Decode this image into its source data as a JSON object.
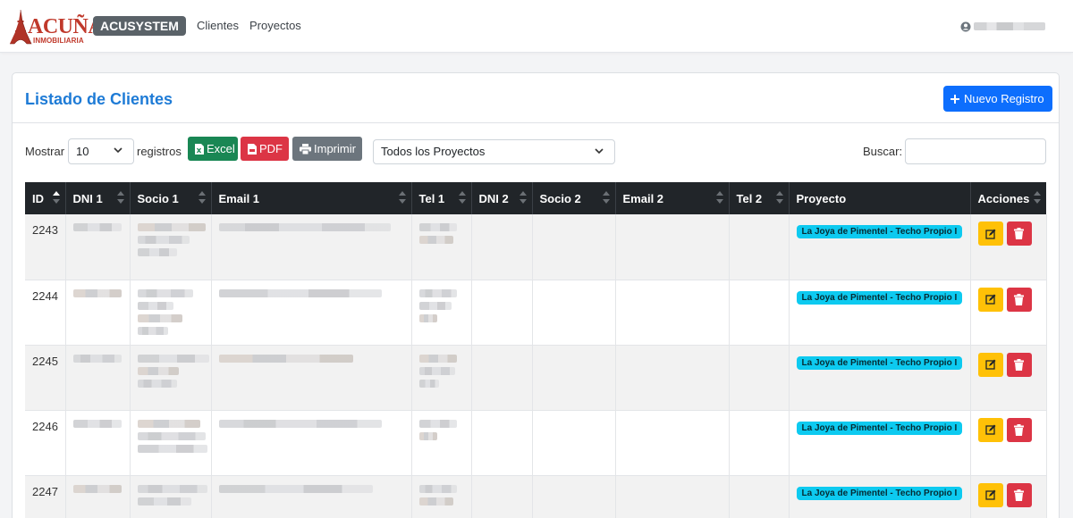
{
  "brand": {
    "logo_text": "ACUÑA",
    "logo_sub": "INMOBILIARIA",
    "app_badge": "ACUSYSTEM"
  },
  "nav": {
    "items": [
      {
        "label": "Clientes"
      },
      {
        "label": "Proyectos"
      }
    ]
  },
  "card": {
    "title": "Listado de Clientes",
    "new_button": "Nuevo Registro"
  },
  "toolbar": {
    "show_label": "Mostrar",
    "page_length": "10",
    "records_label": "registros",
    "excel": "Excel",
    "pdf": "PDF",
    "print": "Imprimir",
    "project_filter": "Todos los Proyectos",
    "search_label": "Buscar:",
    "search_value": ""
  },
  "table": {
    "columns": [
      "ID",
      "DNI 1",
      "Socio 1",
      "Email 1",
      "Tel 1",
      "DNI 2",
      "Socio 2",
      "Email 2",
      "Tel 2",
      "Proyecto",
      "Acciones"
    ],
    "rows": [
      {
        "id": "2243",
        "proyecto": "La Joya de Pimentel - Techo Propio I"
      },
      {
        "id": "2244",
        "proyecto": "La Joya de Pimentel - Techo Propio I"
      },
      {
        "id": "2245",
        "proyecto": "La Joya de Pimentel - Techo Propio I"
      },
      {
        "id": "2246",
        "proyecto": "La Joya de Pimentel - Techo Propio I"
      },
      {
        "id": "2247",
        "proyecto": "La Joya de Pimentel - Techo Propio I"
      }
    ]
  },
  "colors": {
    "primary": "#0d6efd",
    "title_blue": "#1e7bd6",
    "excel_green": "#198754",
    "pdf_red": "#dc3545",
    "print_gray": "#6c757d",
    "header_dark": "#212529",
    "badge_cyan": "#0dcaf0",
    "edit_yellow": "#ffc107",
    "logo_red": "#c0392b"
  },
  "icons": [
    "eiffel-tower-logo-icon",
    "user-icon",
    "plus-icon",
    "chevron-down-icon",
    "file-excel-icon",
    "file-pdf-icon",
    "printer-icon",
    "sort-arrows-icon",
    "edit-icon",
    "trash-icon"
  ]
}
